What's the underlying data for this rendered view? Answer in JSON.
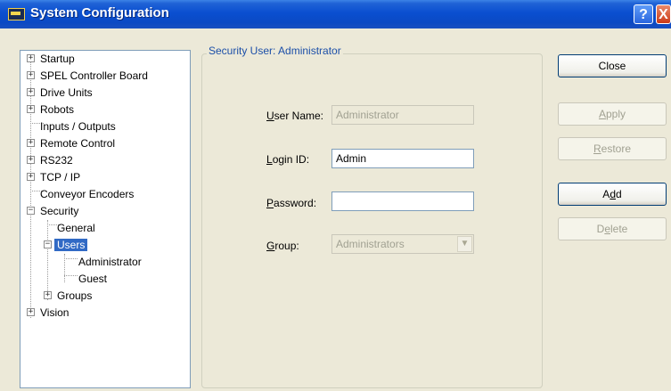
{
  "window": {
    "title": "System Configuration",
    "help_label": "?",
    "close_label": "X"
  },
  "tree": {
    "items": [
      {
        "label": "Startup",
        "expander": "+"
      },
      {
        "label": "SPEL Controller Board",
        "expander": "+"
      },
      {
        "label": "Drive Units",
        "expander": "+"
      },
      {
        "label": "Robots",
        "expander": "+"
      },
      {
        "label": "Inputs / Outputs",
        "expander": ""
      },
      {
        "label": "Remote Control",
        "expander": "+"
      },
      {
        "label": "RS232",
        "expander": "+"
      },
      {
        "label": "TCP / IP",
        "expander": "+"
      },
      {
        "label": "Conveyor Encoders",
        "expander": ""
      },
      {
        "label": "Security",
        "expander": "−"
      },
      {
        "label": "General",
        "expander": ""
      },
      {
        "label": "Users",
        "expander": "−",
        "selected": true
      },
      {
        "label": "Administrator",
        "expander": ""
      },
      {
        "label": "Guest",
        "expander": ""
      },
      {
        "label": "Groups",
        "expander": "+"
      },
      {
        "label": "Vision",
        "expander": "+"
      }
    ]
  },
  "panel": {
    "group_title": "Security User: Administrator",
    "username_label_u": "U",
    "username_label_rest": "ser Name:",
    "username_value": "Administrator",
    "loginid_label_u": "L",
    "loginid_label_rest": "ogin ID:",
    "loginid_value": "Admin",
    "password_label_u": "P",
    "password_label_rest": "assword:",
    "password_value": "",
    "group_label_u": "G",
    "group_label_rest": "roup:",
    "group_value": "Administrators"
  },
  "buttons": {
    "close": "Close",
    "apply_u": "A",
    "apply_rest": "pply",
    "restore_u": "R",
    "restore_rest": "estore",
    "add_pre": "A",
    "add_u": "d",
    "add_post": "d",
    "delete_pre": "D",
    "delete_u": "e",
    "delete_post": "lete"
  }
}
